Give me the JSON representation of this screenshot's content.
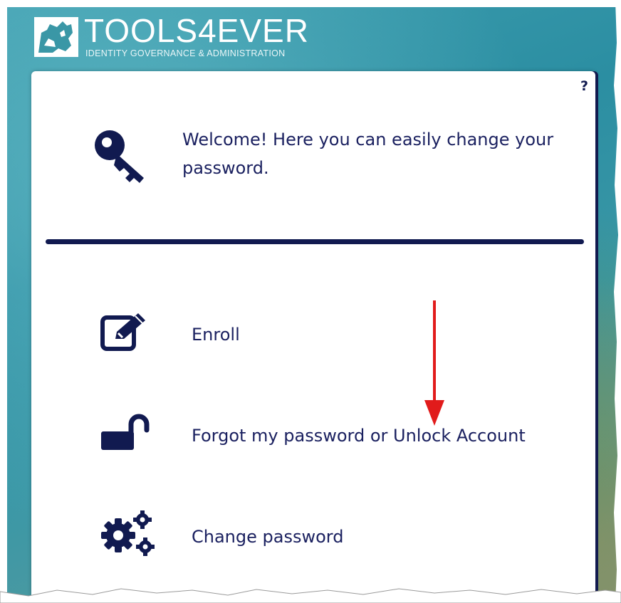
{
  "brand": {
    "title": "TOOLS4EVER",
    "subtitle": "IDENTITY GOVERNANCE & ADMINISTRATION",
    "logo_icon": "map-logo-icon"
  },
  "header": {
    "help_label": "?",
    "welcome_text": "Welcome! Here you can easily change your password.",
    "key_icon": "key-icon"
  },
  "menu": {
    "items": [
      {
        "label": "Enroll",
        "icon": "edit-icon"
      },
      {
        "label": "Forgot my password or Unlock Account",
        "icon": "unlock-icon"
      },
      {
        "label": "Change password",
        "icon": "gears-icon"
      }
    ]
  },
  "colors": {
    "primary": "#111a50",
    "text": "#1b2160",
    "annotation_arrow": "#e11b1b",
    "background_sea": "#3a97a6"
  }
}
